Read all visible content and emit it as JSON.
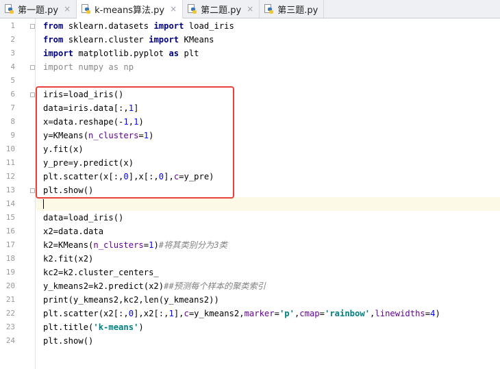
{
  "tabs": [
    {
      "label": "第一题.py",
      "close": "×",
      "active": false
    },
    {
      "label": "k-means算法.py",
      "close": "×",
      "active": true
    },
    {
      "label": "第二题.py",
      "close": "×",
      "active": false
    },
    {
      "label": "第三题.py",
      "close": "×",
      "active": false
    }
  ],
  "editor": {
    "current_line": 14,
    "accent_highlight": "#e8413a",
    "lines": [
      {
        "no": "1",
        "tokens": [
          {
            "t": "from",
            "c": "kw"
          },
          {
            "t": " sklearn.datasets ",
            "c": ""
          },
          {
            "t": "import",
            "c": "kw"
          },
          {
            "t": " load_iris",
            "c": ""
          }
        ]
      },
      {
        "no": "2",
        "tokens": [
          {
            "t": "from",
            "c": "kw"
          },
          {
            "t": " sklearn.cluster ",
            "c": ""
          },
          {
            "t": "import",
            "c": "kw"
          },
          {
            "t": " KMeans",
            "c": ""
          }
        ]
      },
      {
        "no": "3",
        "tokens": [
          {
            "t": "import",
            "c": "kw"
          },
          {
            "t": " matplotlib.pyplot ",
            "c": ""
          },
          {
            "t": "as",
            "c": "kw"
          },
          {
            "t": " plt",
            "c": ""
          }
        ]
      },
      {
        "no": "4",
        "tokens": [
          {
            "t": "import numpy as np",
            "c": "dim"
          }
        ]
      },
      {
        "no": "5",
        "tokens": []
      },
      {
        "no": "6",
        "tokens": [
          {
            "t": "iris=load_iris()",
            "c": ""
          }
        ]
      },
      {
        "no": "7",
        "tokens": [
          {
            "t": "data=iris.data[:,",
            "c": ""
          },
          {
            "t": "1",
            "c": "num"
          },
          {
            "t": "]",
            "c": ""
          }
        ]
      },
      {
        "no": "8",
        "tokens": [
          {
            "t": "x=data.reshape(-",
            "c": ""
          },
          {
            "t": "1",
            "c": "num"
          },
          {
            "t": ",",
            "c": ""
          },
          {
            "t": "1",
            "c": "num"
          },
          {
            "t": ")",
            "c": ""
          }
        ]
      },
      {
        "no": "9",
        "tokens": [
          {
            "t": "y=KMeans(",
            "c": ""
          },
          {
            "t": "n_clusters",
            "c": "param"
          },
          {
            "t": "=",
            "c": ""
          },
          {
            "t": "1",
            "c": "num"
          },
          {
            "t": ")",
            "c": ""
          }
        ]
      },
      {
        "no": "10",
        "tokens": [
          {
            "t": "y.fit(x)",
            "c": ""
          }
        ]
      },
      {
        "no": "11",
        "tokens": [
          {
            "t": "y_pre=y.predict(x)",
            "c": ""
          }
        ]
      },
      {
        "no": "12",
        "tokens": [
          {
            "t": "plt.scatter(x[:,",
            "c": ""
          },
          {
            "t": "0",
            "c": "num"
          },
          {
            "t": "],x[:,",
            "c": ""
          },
          {
            "t": "0",
            "c": "num"
          },
          {
            "t": "],",
            "c": ""
          },
          {
            "t": "c",
            "c": "param"
          },
          {
            "t": "=y_pre)",
            "c": ""
          }
        ]
      },
      {
        "no": "13",
        "tokens": [
          {
            "t": "plt.show()",
            "c": ""
          }
        ]
      },
      {
        "no": "14",
        "tokens": []
      },
      {
        "no": "15",
        "tokens": [
          {
            "t": "data=load_iris()",
            "c": ""
          }
        ]
      },
      {
        "no": "16",
        "tokens": [
          {
            "t": "x2=data.data",
            "c": ""
          }
        ]
      },
      {
        "no": "17",
        "tokens": [
          {
            "t": "k2=KMeans(",
            "c": ""
          },
          {
            "t": "n_clusters",
            "c": "param"
          },
          {
            "t": "=",
            "c": ""
          },
          {
            "t": "1",
            "c": "num"
          },
          {
            "t": ")",
            "c": ""
          },
          {
            "t": "#将其类别分为3类",
            "c": "comment"
          }
        ]
      },
      {
        "no": "18",
        "tokens": [
          {
            "t": "k2.fit(x2)",
            "c": ""
          }
        ]
      },
      {
        "no": "19",
        "tokens": [
          {
            "t": "kc2=k2.cluster_centers_",
            "c": ""
          }
        ]
      },
      {
        "no": "20",
        "tokens": [
          {
            "t": "y_kmeans2=k2.predict(x2)",
            "c": ""
          },
          {
            "t": "##预测每个样本的聚类索引",
            "c": "comment"
          }
        ]
      },
      {
        "no": "21",
        "tokens": [
          {
            "t": "print(y_kmeans2,kc2,len(y_kmeans2))",
            "c": ""
          }
        ]
      },
      {
        "no": "22",
        "tokens": [
          {
            "t": "plt.scatter(x2[:,",
            "c": ""
          },
          {
            "t": "0",
            "c": "num"
          },
          {
            "t": "],x2[:,",
            "c": ""
          },
          {
            "t": "1",
            "c": "num"
          },
          {
            "t": "],",
            "c": ""
          },
          {
            "t": "c",
            "c": "param"
          },
          {
            "t": "=y_kmeans2,",
            "c": ""
          },
          {
            "t": "marker",
            "c": "param"
          },
          {
            "t": "=",
            "c": ""
          },
          {
            "t": "'p'",
            "c": "str"
          },
          {
            "t": ",",
            "c": ""
          },
          {
            "t": "cmap",
            "c": "param"
          },
          {
            "t": "=",
            "c": ""
          },
          {
            "t": "'rainbow'",
            "c": "str"
          },
          {
            "t": ",",
            "c": ""
          },
          {
            "t": "linewidths",
            "c": "param"
          },
          {
            "t": "=",
            "c": ""
          },
          {
            "t": "4",
            "c": "num"
          },
          {
            "t": ")",
            "c": ""
          }
        ]
      },
      {
        "no": "23",
        "tokens": [
          {
            "t": "plt.title(",
            "c": ""
          },
          {
            "t": "'k-means'",
            "c": "str"
          },
          {
            "t": ")",
            "c": ""
          }
        ]
      },
      {
        "no": "24",
        "tokens": [
          {
            "t": "plt.show()",
            "c": ""
          }
        ]
      }
    ]
  }
}
